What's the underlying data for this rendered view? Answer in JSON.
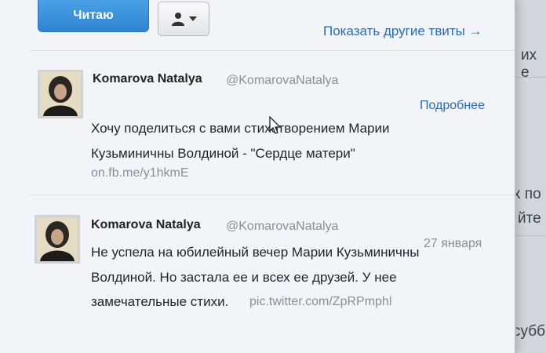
{
  "header": {
    "follow_label": "Читаю",
    "user_menu_icon": "person-icon",
    "show_more_label": "Показать другие твиты →"
  },
  "tweets": [
    {
      "author_name": "Komarova Natalya",
      "handle": "@KomarovaNatalya",
      "meta": "Подробнее",
      "lines": [
        "Хочу поделиться с вами стихотворением Марии",
        "Кузьминичны Волдиной - \"Сердце матери\""
      ],
      "link": "on.fb.me/y1hkmE"
    },
    {
      "author_name": "Komarova Natalya",
      "handle": "@KomarovaNatalya",
      "meta": "27 января",
      "lines": [
        "Не успела на юбилейный вечер Марии Кузьминичны",
        "Волдиной. Но застала ее и всех ее друзей. У нее",
        "замечательные стихи."
      ],
      "link": "pic.twitter.com/ZpRPmphl"
    }
  ],
  "background": {
    "fragments": [
      "их е",
      "х по",
      "йте",
      "субб"
    ]
  },
  "colors": {
    "accent": "#2f84cf",
    "link": "#2d6aa8",
    "muted": "#8a8e95"
  }
}
